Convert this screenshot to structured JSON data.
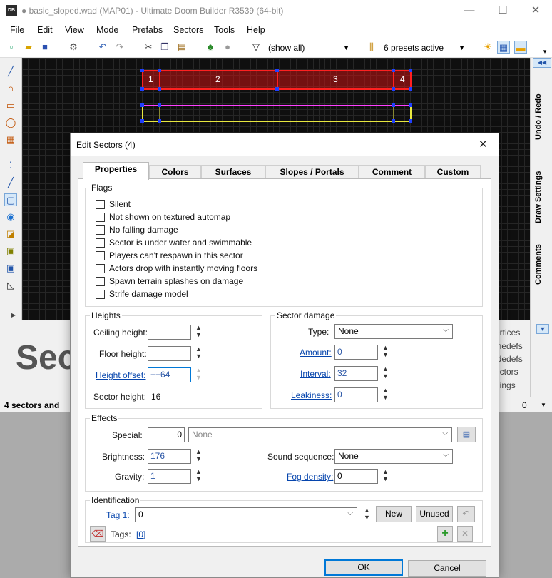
{
  "window": {
    "app_icon": "DB",
    "title": "● basic_sloped.wad (MAP01) - Ultimate Doom Builder R3539 (64-bit)",
    "min": "—",
    "max": "☐",
    "close": "✕"
  },
  "menu": [
    "File",
    "Edit",
    "View",
    "Mode",
    "Prefabs",
    "Sectors",
    "Tools",
    "Help"
  ],
  "toolbar": {
    "filter_value": "(show all)",
    "presets_value": "6 presets active"
  },
  "map_labels": [
    "1",
    "2",
    "3",
    "4"
  ],
  "side_tabs": [
    "Undo / Redo",
    "Draw Settings",
    "Comments"
  ],
  "info": {
    "big_text": "Sec",
    "right_items": [
      "ertices",
      "inedefs",
      "idedefs",
      "ectors",
      "hings"
    ]
  },
  "status": {
    "left": "4 sectors and",
    "right": "0"
  },
  "dialog": {
    "title": "Edit Sectors (4)",
    "close": "✕",
    "tabs": [
      "Properties",
      "Colors",
      "Surfaces",
      "Slopes / Portals",
      "Comment",
      "Custom"
    ],
    "flags": {
      "label": "Flags",
      "items": [
        "Silent",
        "Not shown on textured automap",
        "No falling damage",
        "Sector is under water and swimmable",
        "Players can't respawn in this sector",
        "Actors drop with instantly moving floors",
        "Spawn terrain splashes on damage",
        "Strife damage model"
      ]
    },
    "heights": {
      "label": "Heights",
      "ceiling_label": "Ceiling height:",
      "ceiling_value": "",
      "floor_label": "Floor height:",
      "floor_value": "",
      "offset_label": "Height offset:",
      "offset_value": "++64",
      "sector_height_label": "Sector height:",
      "sector_height_value": "16"
    },
    "damage": {
      "label": "Sector damage",
      "type_label": "Type:",
      "type_value": "None",
      "amount_label": "Amount:",
      "amount_value": "0",
      "interval_label": "Interval:",
      "interval_value": "32",
      "leakiness_label": "Leakiness:",
      "leakiness_value": "0"
    },
    "effects": {
      "label": "Effects",
      "special_label": "Special:",
      "special_num": "0",
      "special_value": "None",
      "brightness_label": "Brightness:",
      "brightness_value": "176",
      "gravity_label": "Gravity:",
      "gravity_value": "1",
      "sound_label": "Sound sequence:",
      "sound_value": "None",
      "fog_label": "Fog density:",
      "fog_value": "0"
    },
    "identification": {
      "label": "Identification",
      "tag_label": "Tag 1:",
      "tag_value": "0",
      "new_label": "New",
      "unused_label": "Unused",
      "tags_label": "Tags:",
      "tags_value": "[0]"
    },
    "ok_label": "OK",
    "cancel_label": "Cancel"
  }
}
